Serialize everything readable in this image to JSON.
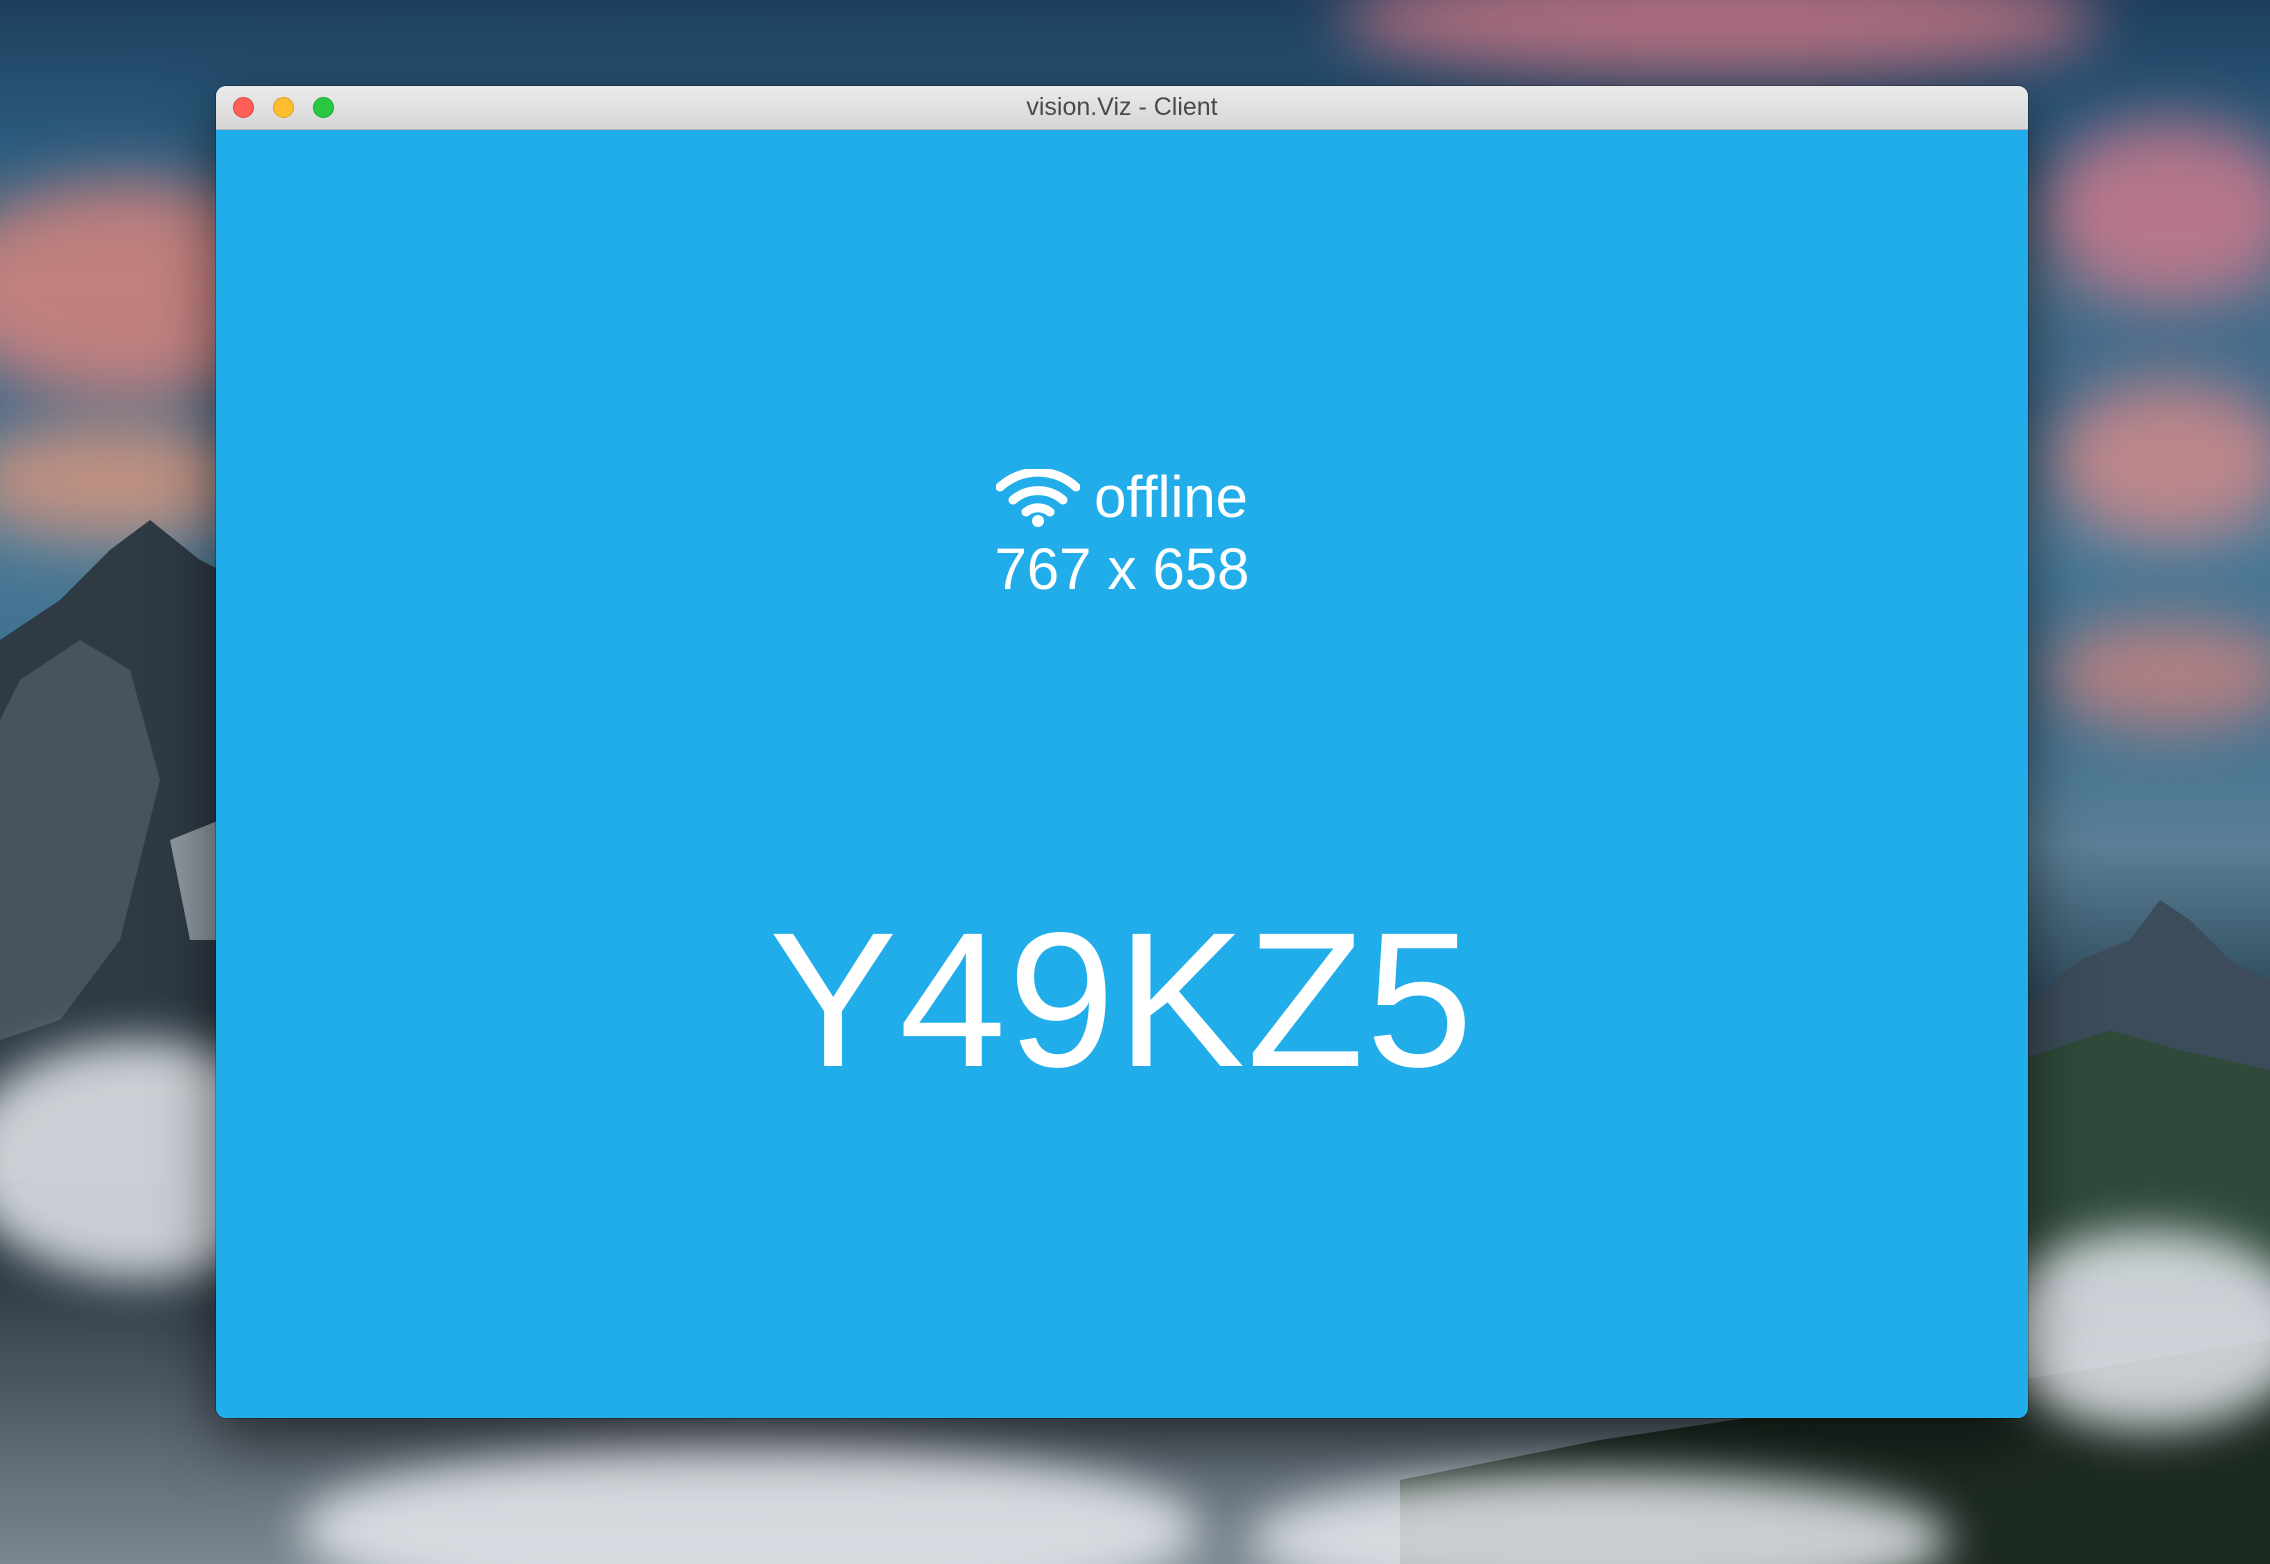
{
  "window": {
    "title": "vision.Viz - Client"
  },
  "status": {
    "icon": "wifi-icon",
    "text": "offline"
  },
  "resolution": "767 x 658",
  "code": "Y49KZ5",
  "colors": {
    "content_background": "#21ade9",
    "text": "#ffffff"
  }
}
